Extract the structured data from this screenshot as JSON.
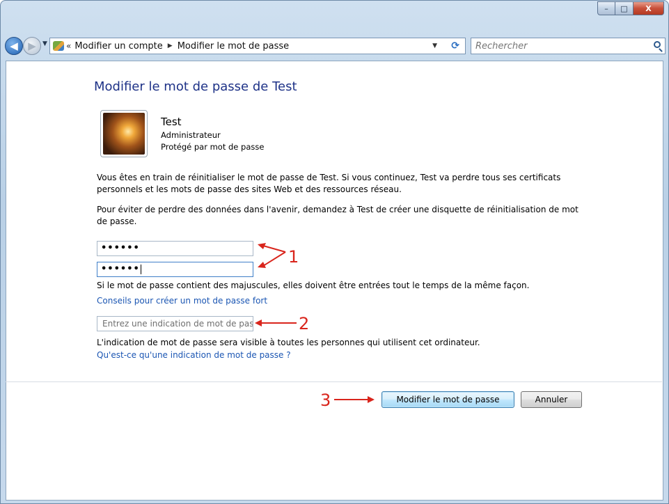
{
  "window": {
    "caption_minimize": "–",
    "caption_maximize": "□",
    "caption_close": "X"
  },
  "navbar": {
    "breadcrumb_prefix": "«",
    "breadcrumb": [
      "Modifier un compte",
      "Modifier le mot de passe"
    ],
    "search_placeholder": "Rechercher"
  },
  "page": {
    "title": "Modifier le mot de passe de Test",
    "user": {
      "name": "Test",
      "role": "Administrateur",
      "status": "Protégé par mot de passe"
    },
    "warning_text": "Vous êtes en train de réinitialiser le mot de passe de Test. Si vous continuez, Test va perdre tous ses certificats personnels et les mots de passe des sites Web et des ressources réseau.",
    "advice_text": "Pour éviter de perdre des données dans l'avenir, demandez à Test de créer une disquette de réinitialisation de mot de passe.",
    "new_password_value": "••••••",
    "confirm_password_value": "••••••",
    "case_note": "Si le mot de passe contient des majuscules, elles doivent être entrées tout le temps de la même façon.",
    "strong_password_link": "Conseils pour créer un mot de passe fort",
    "hint_placeholder": "Entrez une indication de mot de passe",
    "hint_note": "L'indication de mot de passe sera visible à toutes les personnes qui utilisent cet ordinateur.",
    "hint_help_link": "Qu'est-ce qu'une indication de mot de passe ?"
  },
  "buttons": {
    "change_password": "Modifier le mot de passe",
    "cancel": "Annuler"
  },
  "annotations": {
    "label_1": "1",
    "label_2": "2",
    "label_3": "3",
    "color": "#d9251c"
  }
}
